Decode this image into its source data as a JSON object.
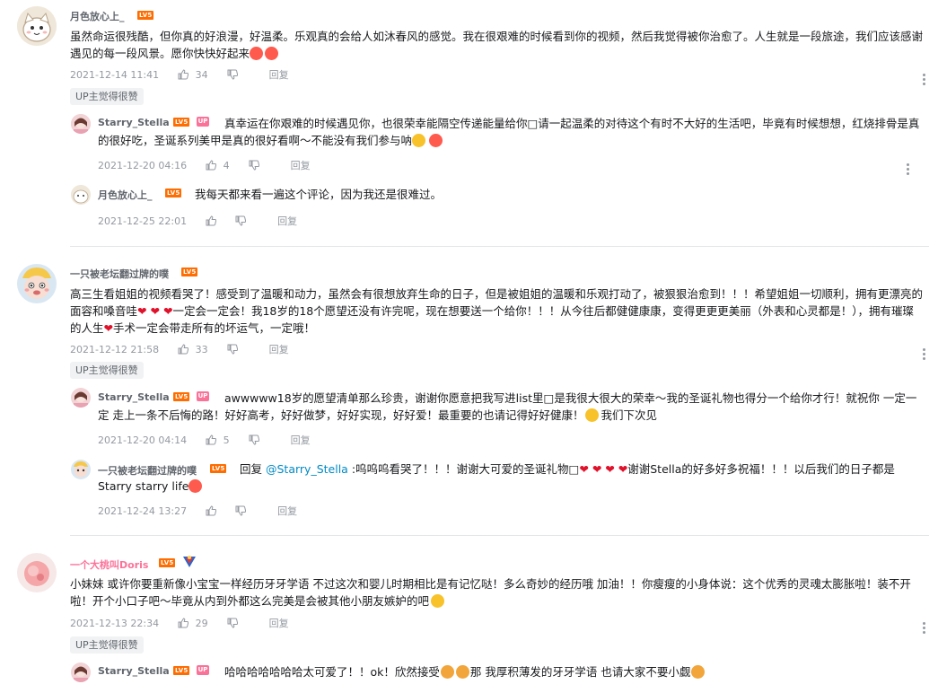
{
  "colors": {
    "level_badge": "#ff6c00",
    "up_badge": "#fb7299",
    "link": "#008ac5",
    "meta": "#9499a0"
  },
  "comments": [
    {
      "user": "月色放心上_",
      "level": "LV5",
      "text": "虽然命运很残酷，但你真的好浪漫，好温柔。乐观真的会给人如沐春风的感觉。我在很艰难的时候看到你的视频，然后我觉得被你治愈了。人生就是一段旅途，我们应该感谢遇见的每一段风景。愿你快快好起来",
      "time": "2021-12-14 11:41",
      "likes": "34",
      "reply_label": "回复",
      "tag": "UP主觉得很赞",
      "replies": [
        {
          "user": "Starry_Stella",
          "level": "LV5",
          "up": "UP",
          "text": "真幸运在你艰难的时候遇见你，也很荣幸能隔空传递能量给你□请一起温柔的对待这个有时不大好的生活吧，毕竟有时候想想，红烧排骨是真的很好吃，圣诞系列美甲是真的很好看啊～不能没有我们参与呐",
          "time": "2021-12-20 04:16",
          "likes": "4",
          "reply_label": "回复"
        },
        {
          "user": "月色放心上_",
          "level": "LV5",
          "text": "我每天都来看一遍这个评论，因为我还是很难过。",
          "time": "2021-12-25 22:01",
          "reply_label": "回复"
        }
      ]
    },
    {
      "user": "一只被老坛翻过牌的噗",
      "level": "LV5",
      "text_a": "高三生看姐姐的视频看哭了！感受到了温暖和动力，虽然会有很想放弃生命的日子，但是被姐姐的温暖和乐观打动了，被狠狠治愈到！！！希望姐姐一切顺利，拥有更漂亮的面容和嗓音哇",
      "text_b": "一定会一定会！我18岁的18个愿望还没有许完呢，现在想要送一个给你！！！从今往后都健健康康，变得更更更美丽（外表和心灵都是！），拥有璀璨的人生",
      "text_c": "手术一定会带走所有的坏运气，一定哦！",
      "time": "2021-12-12 21:58",
      "likes": "33",
      "reply_label": "回复",
      "tag": "UP主觉得很赞",
      "replies": [
        {
          "user": "Starry_Stella",
          "level": "LV5",
          "up": "UP",
          "text": "awwwww18岁的愿望清单那么珍贵，谢谢你愿意把我写进list里□是我很大很大的荣幸～我的圣诞礼物也得分一个给你才行！就祝你 一定一定 走上一条不后悔的路！好好高考，好好做梦，好好实现，好好爱！最重要的也请记得好好健康！",
          "text_end": "我们下次见",
          "time": "2021-12-20 04:14",
          "likes": "5",
          "reply_label": "回复"
        },
        {
          "user": "一只被老坛翻过牌的噗",
          "level": "LV5",
          "reply_prefix": "回复",
          "mention": "@Starry_Stella",
          "text_a": ":呜呜呜看哭了！！！谢谢大可爱的圣诞礼物□",
          "text_b": "谢谢Stella的好多好多祝福！！！以后我们的日子都是Starry starry life",
          "time": "2021-12-24 13:27",
          "reply_label": "回复"
        }
      ]
    },
    {
      "user": "一个大桃叫Doris",
      "level": "LV5",
      "text": "小妹妹 或许你要重新像小宝宝一样经历牙牙学语 不过这次和婴儿时期相比是有记忆哒！多么奇妙的经历哦 加油！！你瘦瘦的小身体说：这个优秀的灵魂太膨胀啦！装不开啦！开个小口子吧～毕竟从内到外都这么完美是会被其他小朋友嫉妒的吧",
      "time": "2021-12-13 22:34",
      "likes": "29",
      "reply_label": "回复",
      "tag": "UP主觉得很赞",
      "replies": [
        {
          "user": "Starry_Stella",
          "level": "LV5",
          "up": "UP",
          "text_a": "哈哈哈哈哈哈哈太可爱了！！ok！欣然接受",
          "text_b": "那 我厚积薄发的牙牙学语 也请大家不要小觑"
        }
      ]
    }
  ]
}
